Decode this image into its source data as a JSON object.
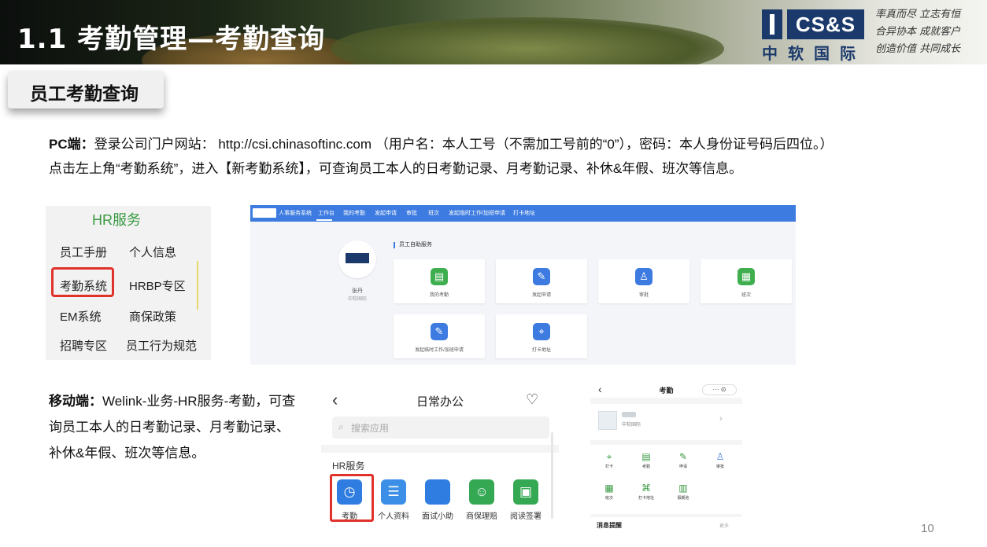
{
  "header": {
    "title": "1.1 考勤管理—考勤查询",
    "logo": {
      "latin": "CS&S",
      "cn": "中软国际"
    },
    "slogan": [
      "率真而尽 立志有恒",
      "合异协本 成就客户",
      "创造价值 共同成长"
    ]
  },
  "section_tag": "员工考勤查询",
  "pc": {
    "label": "PC端：",
    "line1": "登录公司门户网站： http://csi.chinasoftinc.com （用户名：本人工号（不需加工号前的“0”），密码：本人身份证号码后四位。）",
    "line2": "点击左上角“考勤系统”，进入【新考勤系统】，可查询员工本人的日考勤记录、月考勤记录、补休&年假、班次等信息。"
  },
  "hr_menu": {
    "title": "HR服务",
    "items": [
      "员工手册",
      "个人信息",
      "考勤系统",
      "HRBP专区",
      "EM系统",
      "商保政策",
      "招聘专区",
      "员工行为规范"
    ]
  },
  "pc_shot": {
    "nav": [
      "人事服务系统",
      "工作台",
      "我的考勤",
      "发起申请",
      "审批",
      "班次",
      "发起临时工作/加班申请",
      "打卡地址"
    ],
    "section_label": "员工自助服务",
    "user_name": "张丹",
    "user_org": "中软国际",
    "cards": [
      "我的考勤",
      "发起申请",
      "审批",
      "班次",
      "发起临时工作/加班申请",
      "打卡地址"
    ]
  },
  "mobile": {
    "label": "移动端：",
    "text": "Welink-业务-HR服务-考勤，可查询员工本人的日考勤记录、月考勤记录、补休&年假、班次等信息。"
  },
  "mob1": {
    "title": "日常办公",
    "search_placeholder": "搜索应用",
    "group": "HR服务",
    "apps": [
      "考勤",
      "个人资料",
      "面试小助",
      "商保理赔",
      "阅读签署"
    ]
  },
  "mob2": {
    "title": "考勤",
    "capsule": "··· ⊙",
    "org": "中软国际",
    "grid": [
      "打卡",
      "考勤",
      "申请",
      "审批",
      "班次",
      "打卡地址",
      "假期池"
    ],
    "msg_title": "消息提醒",
    "msg_more": "更多"
  },
  "page_number": "10",
  "colors": {
    "accent_blue": "#3d7be0",
    "highlight_red": "#e0322b",
    "hr_green": "#3a9a42",
    "brand_navy": "#1b3a6b"
  }
}
